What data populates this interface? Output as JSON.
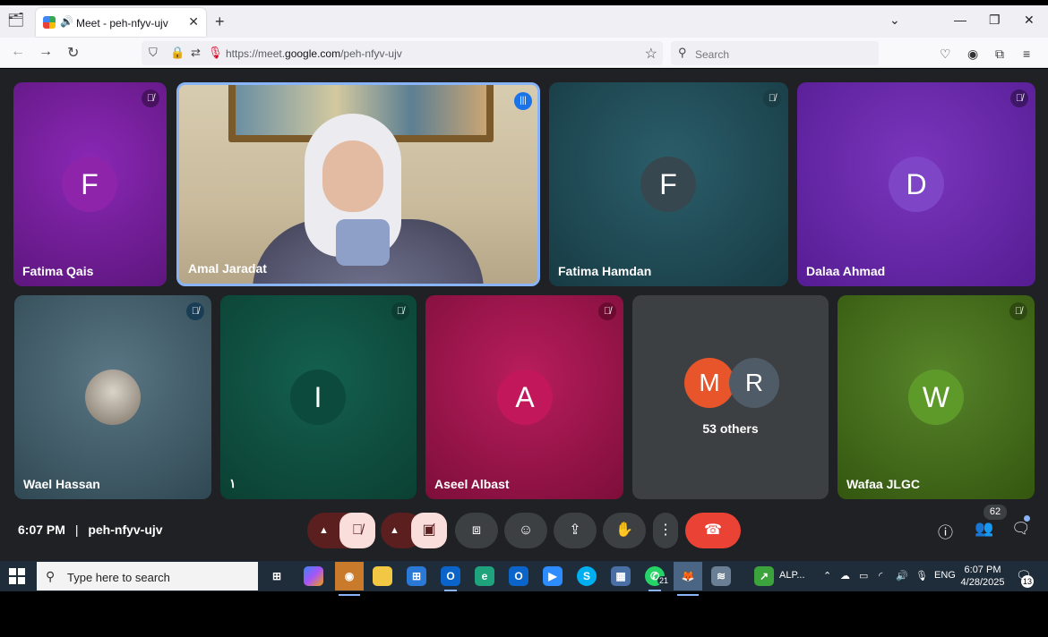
{
  "browser": {
    "tab_title": "Meet - peh-nfyv-ujv",
    "url_prefix": "https://meet.",
    "url_domain": "google.com",
    "url_path": "/peh-nfyv-ujv",
    "search_placeholder": "Search"
  },
  "tiles_row1": [
    {
      "name": "Fatima Qais",
      "initial": "F",
      "bg": "#7a1fa2",
      "avatar_bg": "#8e24aa"
    },
    {
      "name": "Amal Jaradat",
      "video": true
    },
    {
      "name": "Fatima Hamdan",
      "initial": "F",
      "bg": "#1e4a55",
      "avatar_bg": "#37474f"
    },
    {
      "name": "Dalaa Ahmad",
      "initial": "D",
      "bg": "#6a2aa8",
      "avatar_bg": "#7e45c7"
    }
  ],
  "tiles_row2": [
    {
      "name": "Wael Hassan",
      "bg": "#3d5a68"
    },
    {
      "name": "١",
      "initial": "I",
      "bg": "#0f5547",
      "avatar_bg": "#0b4a3d"
    },
    {
      "name": "Aseel Albast",
      "initial": "A",
      "bg": "#a3144f",
      "avatar_bg": "#c2185b"
    },
    {
      "others_label": "53 others",
      "initials": [
        "M",
        "R"
      ],
      "bg": "#3c4043"
    },
    {
      "name": "Wafaa JLGC",
      "initial": "W",
      "bg": "#436b18",
      "avatar_bg": "#5e9a2a"
    }
  ],
  "bottombar": {
    "time": "6:07 PM",
    "separator": "|",
    "meeting_code": "peh-nfyv-ujv",
    "participants_count": "62"
  },
  "taskbar": {
    "search_placeholder": "Type here to search",
    "whatsapp_badge": "21",
    "alp_label": "ALP...",
    "lang": "ENG",
    "time": "6:07 PM",
    "date": "4/28/2025",
    "notifications": "13"
  },
  "colors": {
    "meet_bg": "#202124",
    "hangup": "#ea4335",
    "speaking_outline": "#8ab4f8"
  }
}
